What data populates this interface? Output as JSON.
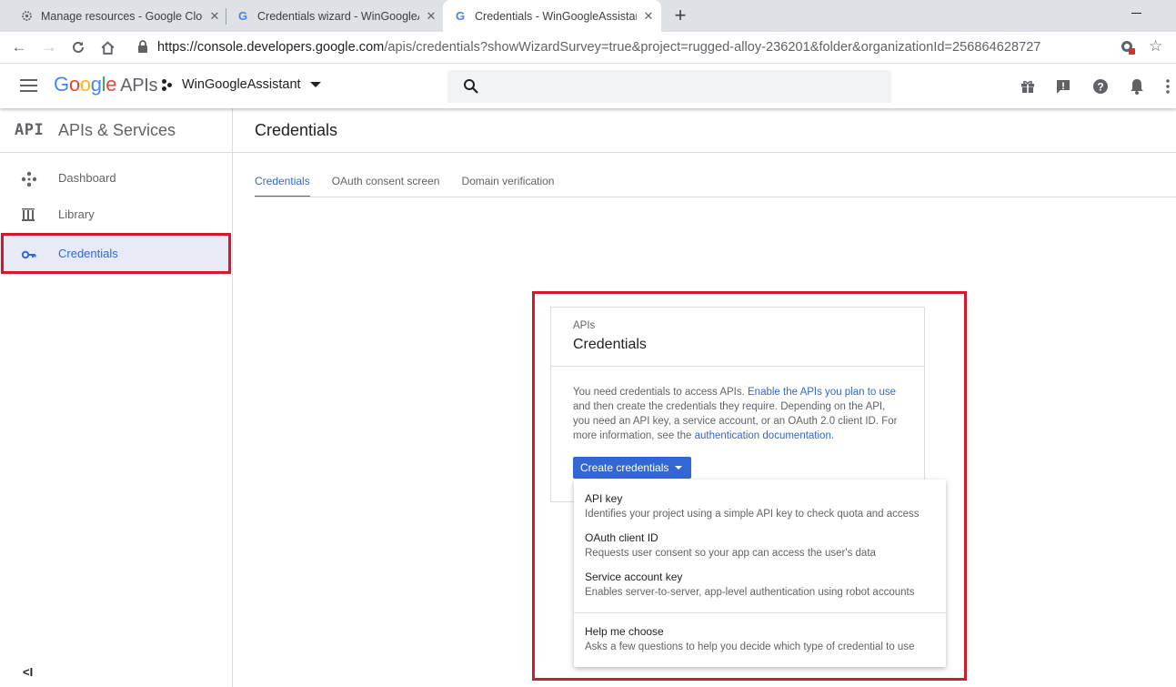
{
  "browser": {
    "tabs": [
      {
        "title": "Manage resources - Google Clou",
        "icon": "gear-icon"
      },
      {
        "title": "Credentials wizard - WinGoogleA",
        "icon": "google-g-icon"
      },
      {
        "title": "Credentials - WinGoogleAssistan",
        "icon": "google-g-icon"
      }
    ],
    "url_host": "https://console.developers.google.com",
    "url_rest": "/apis/credentials?showWizardSurvey=true&project=rugged-alloy-236201&folder&organizationId=256864628727"
  },
  "header": {
    "logo_text": "Google",
    "logo_suffix": "APIs",
    "project_name": "WinGoogleAssistant"
  },
  "sidebar": {
    "badge": "API",
    "title": "APIs & Services",
    "items": [
      {
        "label": "Dashboard",
        "icon": "dashboard-icon"
      },
      {
        "label": "Library",
        "icon": "library-icon"
      },
      {
        "label": "Credentials",
        "icon": "key-icon",
        "active": true
      }
    ],
    "collapse_glyph": "<I"
  },
  "main": {
    "title": "Credentials",
    "tabs": [
      {
        "label": "Credentials",
        "active": true
      },
      {
        "label": "OAuth consent screen"
      },
      {
        "label": "Domain verification"
      }
    ]
  },
  "card": {
    "overline": "APIs",
    "title": "Credentials",
    "text_1": "You need credentials to access APIs. ",
    "link_1": "Enable the APIs you plan to use",
    "text_2": " and then create the credentials they require. Depending on the API, you need an API key, a service account, or an OAuth 2.0 client ID. For more information, see the ",
    "link_2": "authentication documentation",
    "text_3": ".",
    "button_label": "Create credentials"
  },
  "menu": {
    "items": [
      {
        "title": "API key",
        "desc": "Identifies your project using a simple API key to check quota and access"
      },
      {
        "title": "OAuth client ID",
        "desc": "Requests user consent so your app can access the user's data"
      },
      {
        "title": "Service account key",
        "desc": "Enables server-to-server, app-level authentication using robot accounts"
      },
      {
        "title": "Help me choose",
        "desc": "Asks a few questions to help you decide which type of credential to use"
      }
    ]
  },
  "colors": {
    "accent": "#3367d6",
    "highlight_box": "#d31a2b",
    "active_nav_bg": "#e8eaf6"
  }
}
